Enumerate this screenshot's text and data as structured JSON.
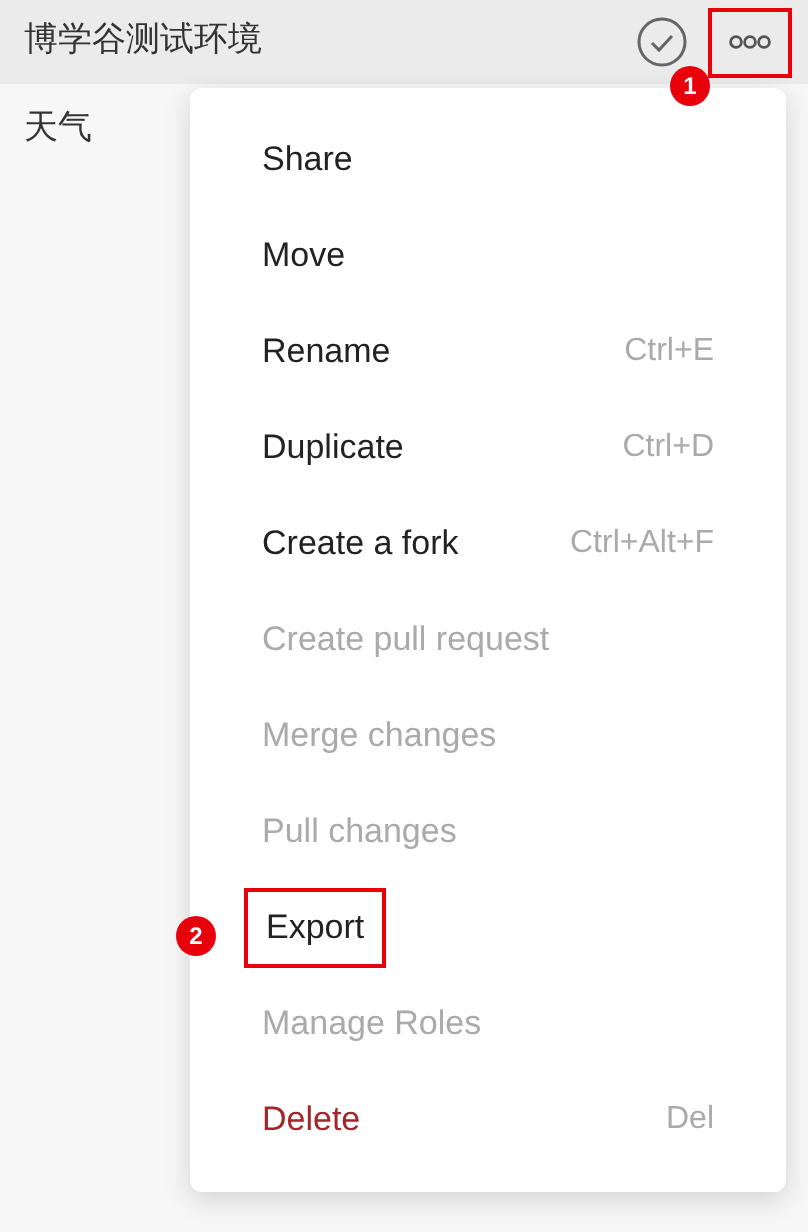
{
  "header": {
    "title": "博学谷测试环境",
    "more_button": {
      "annotation": "1"
    }
  },
  "sidebar": {
    "items": [
      {
        "label": "天气"
      }
    ]
  },
  "menu": {
    "items": [
      {
        "label": "Share",
        "kind": "action",
        "disabled": false
      },
      {
        "label": "Move",
        "kind": "action",
        "disabled": false
      },
      {
        "label": "Rename",
        "shortcut": "Ctrl+E",
        "kind": "action",
        "disabled": false
      },
      {
        "label": "Duplicate",
        "shortcut": "Ctrl+D",
        "kind": "action",
        "disabled": false
      },
      {
        "label": "Create a fork",
        "shortcut": "Ctrl+Alt+F",
        "kind": "action",
        "disabled": false
      },
      {
        "label": "Create pull request",
        "kind": "action",
        "disabled": true
      },
      {
        "label": "Merge changes",
        "kind": "action",
        "disabled": true
      },
      {
        "label": "Pull changes",
        "kind": "action",
        "disabled": true
      },
      {
        "label": "Export",
        "kind": "action",
        "disabled": false,
        "annotation": "2"
      },
      {
        "label": "Manage Roles",
        "kind": "action",
        "disabled": true
      },
      {
        "label": "Delete",
        "shortcut": "Del",
        "kind": "danger",
        "disabled": false
      }
    ]
  }
}
